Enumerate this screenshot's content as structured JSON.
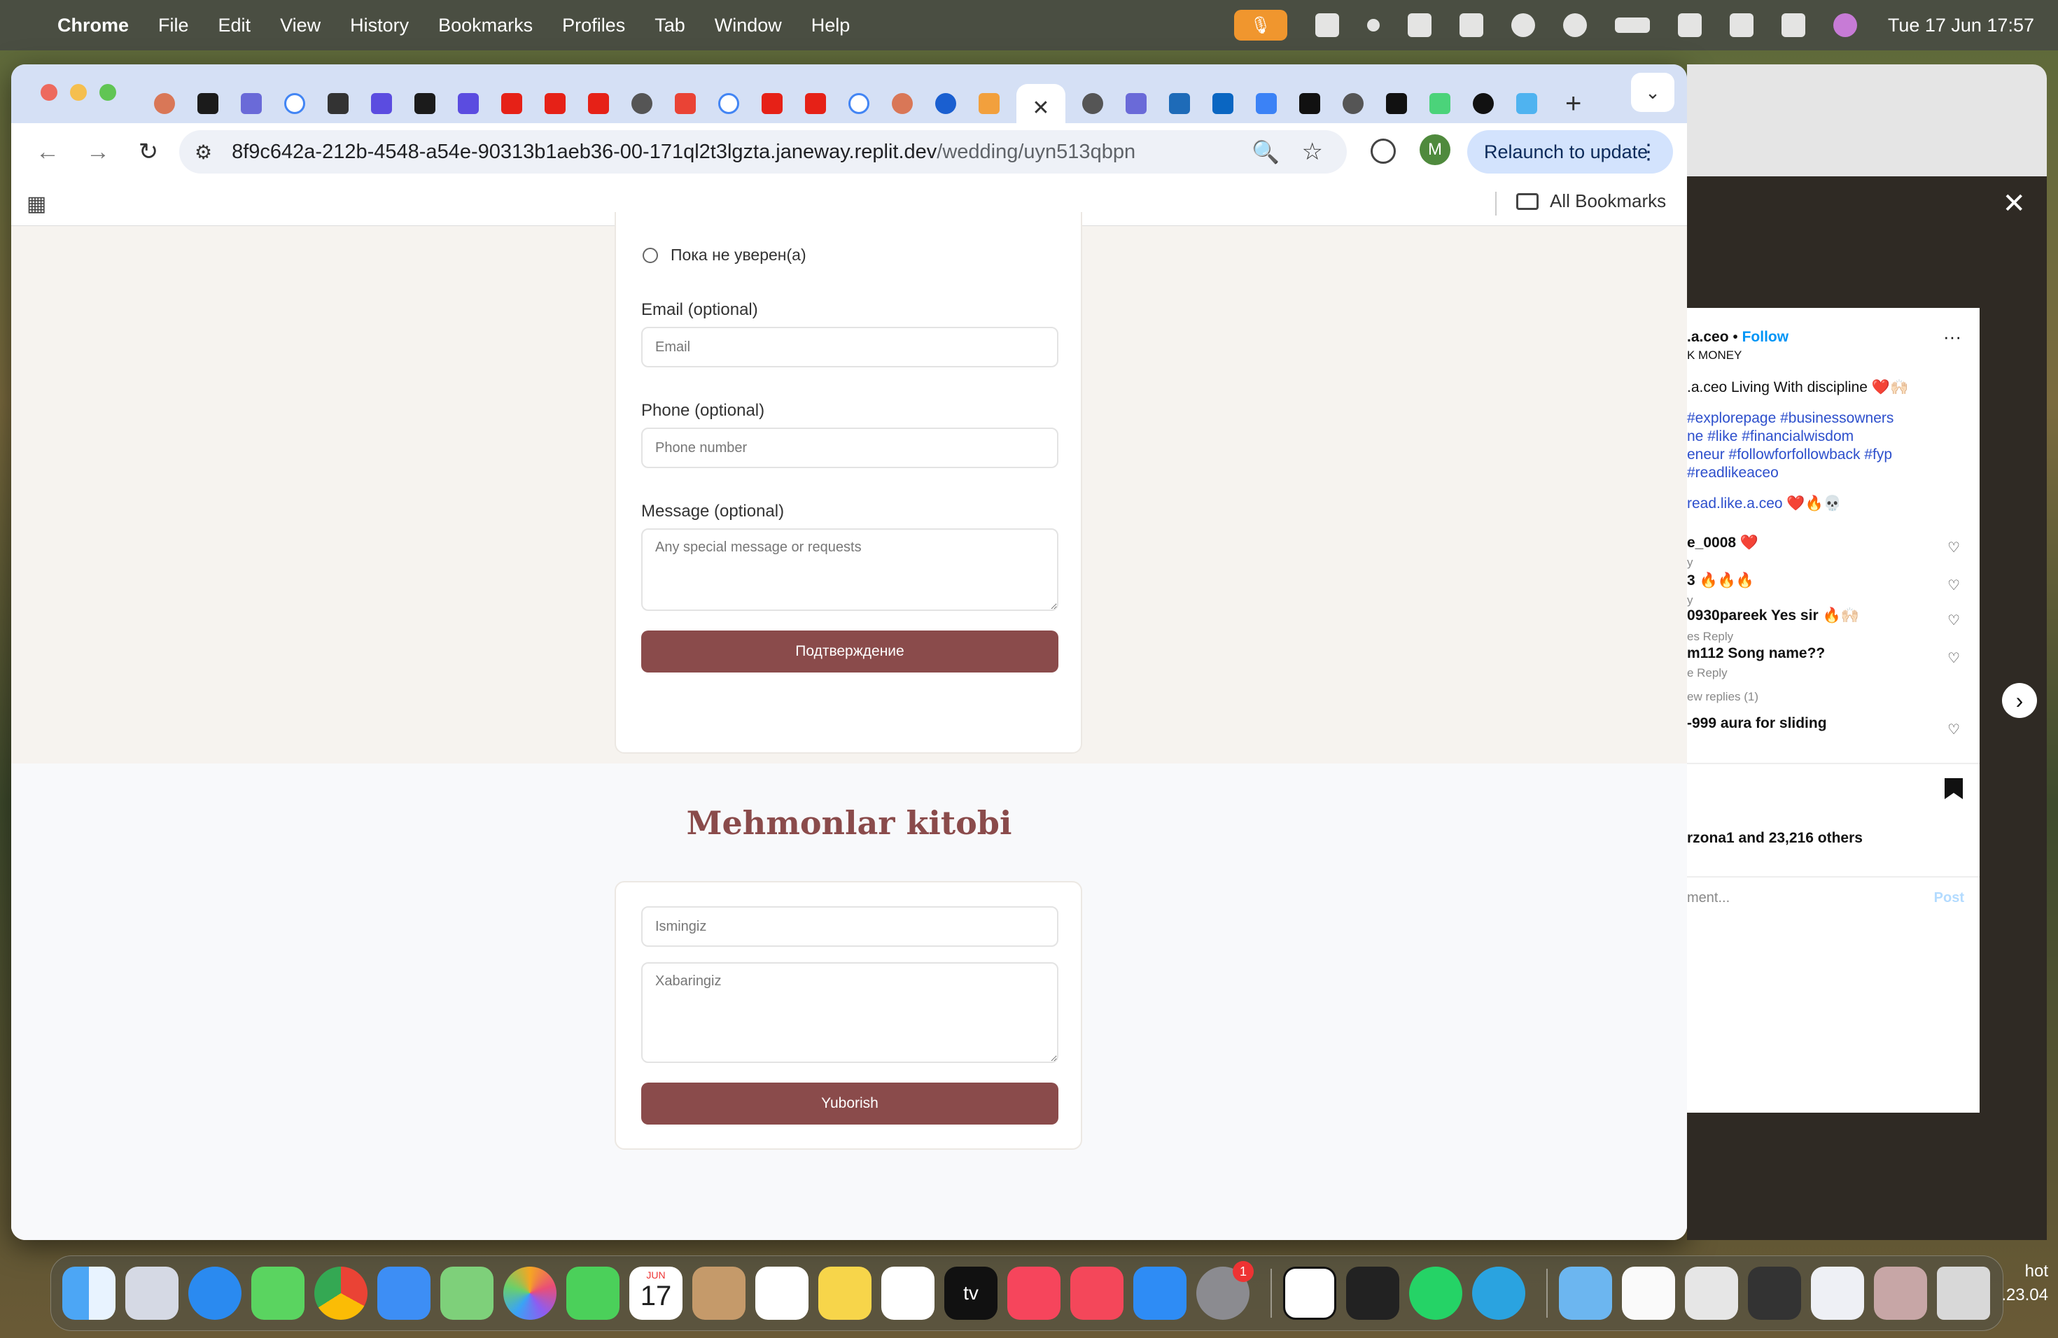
{
  "menubar": {
    "app": "Chrome",
    "menus": [
      "File",
      "Edit",
      "View",
      "History",
      "Bookmarks",
      "Profiles",
      "Tab",
      "Window",
      "Help"
    ],
    "clock": "Tue 17 Jun  17:57"
  },
  "browser": {
    "url_host": "8f9c642a-212b-4548-a54e-90313b1aeb36-00-171ql2t3lgzta.janeway.replit.dev",
    "url_path": "/wedding/uyn513qbpn",
    "relaunch_label": "Relaunch to update",
    "all_bookmarks": "All Bookmarks",
    "profile_initial": "M"
  },
  "rsvp": {
    "radio_unsure": "Пока не уверен(а)",
    "email_label": "Email (optional)",
    "email_placeholder": "Email",
    "phone_label": "Phone (optional)",
    "phone_placeholder": "Phone number",
    "message_label": "Message (optional)",
    "message_placeholder": "Any special message or requests",
    "submit": "Подтверждение"
  },
  "guestbook": {
    "title": "Mehmonlar kitobi",
    "name_placeholder": "Ismingiz",
    "message_placeholder": "Xabaringiz",
    "submit": "Yuborish"
  },
  "instagram": {
    "username": ".a.ceo",
    "follow": "Follow",
    "subtitle": "K MONEY",
    "caption": ".a.ceo Living With discipline ❤️🙌🏻",
    "hashtags": [
      "#explorepage #businessowners",
      "ne #like #financialwisdom",
      "eneur #followforfollowback #fyp",
      " #readlikeaceo"
    ],
    "mention": "read.like.a.ceo ❤️🔥💀",
    "comments": [
      {
        "text": "e_0008 ❤️",
        "meta": "y"
      },
      {
        "text": "3 🔥🔥🔥",
        "meta": "y"
      },
      {
        "text": "0930pareek Yes sir 🔥🙌🏻",
        "meta": "es   Reply"
      },
      {
        "text": "m112 Song name??",
        "meta": "e   Reply"
      },
      {
        "text": "ew replies (1)",
        "meta": ""
      },
      {
        "text": "-999 aura for sliding",
        "meta": ""
      }
    ],
    "likes": "rzona1 and 23,216 others",
    "comment_placeholder": "ment...",
    "post": "Post"
  },
  "dock": {
    "calendar_month": "JUN",
    "calendar_day": "17",
    "tv_label": "tv",
    "settings_badge": "1"
  },
  "desktop_edge": {
    "line1": "hot",
    "line2": ".23.04"
  },
  "colors": {
    "accent": "#8a4b4b",
    "link": "#2d4fcc"
  }
}
